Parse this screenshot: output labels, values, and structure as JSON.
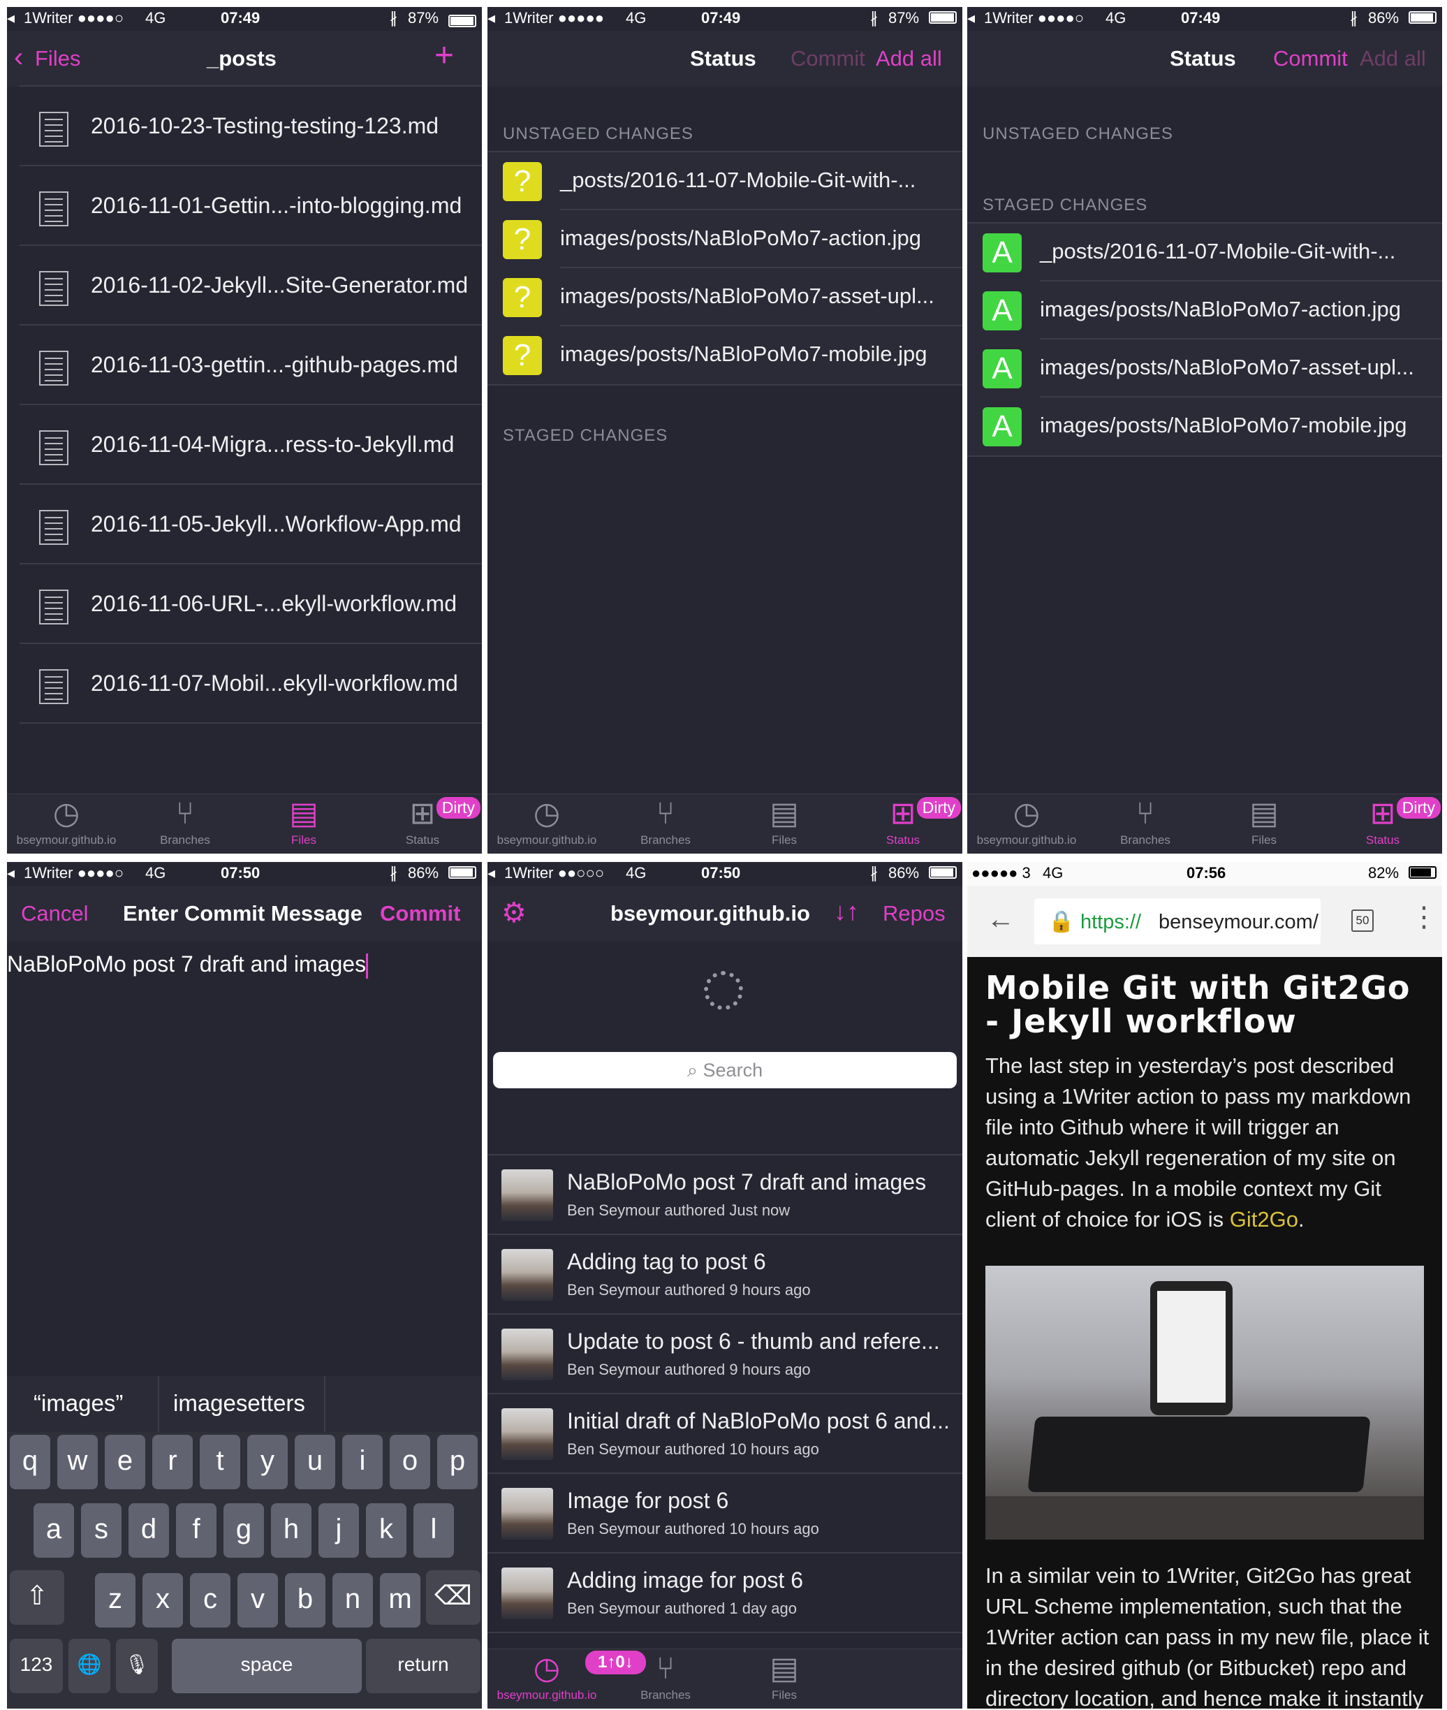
{
  "colors": {
    "accent": "#e040c8",
    "panel_bg": "#252631",
    "untracked": "#dfdc1f",
    "added": "#43d643",
    "link": "#d9c23c"
  },
  "common": {
    "tab_repo": "bseymour.github.io",
    "tab_branches": "Branches",
    "tab_files": "Files",
    "tab_status": "Status",
    "dirty": "Dirty"
  },
  "p1": {
    "carrier": "1Writer ●●●●○",
    "net": "4G",
    "time": "07:49",
    "battery": "87%",
    "back": "Files",
    "title": "_posts",
    "plus": "+",
    "files": [
      "2016-10-23-Testing-testing-123.md",
      "2016-11-01-Gettin...-into-blogging.md",
      "2016-11-02-Jekyll...Site-Generator.md",
      "2016-11-03-gettin...-github-pages.md",
      "2016-11-04-Migra...ress-to-Jekyll.md",
      "2016-11-05-Jekyll...Workflow-App.md",
      "2016-11-06-URL-...ekyll-workflow.md",
      "2016-11-07-Mobil...ekyll-workflow.md"
    ]
  },
  "p2": {
    "carrier": "1Writer ●●●●●",
    "net": "4G",
    "time": "07:49",
    "battery": "87%",
    "title": "Status",
    "commit": "Commit",
    "add_all": "Add all",
    "unstaged": "UNSTAGED CHANGES",
    "staged": "STAGED CHANGES",
    "mark": "?",
    "changes": [
      "_posts/2016-11-07-Mobile-Git-with-...",
      "images/posts/NaBloPoMo7-action.jpg",
      "images/posts/NaBloPoMo7-asset-upl...",
      "images/posts/NaBloPoMo7-mobile.jpg"
    ]
  },
  "p3": {
    "carrier": "1Writer ●●●●○",
    "net": "4G",
    "time": "07:49",
    "battery": "86%",
    "title": "Status",
    "commit": "Commit",
    "add_all": "Add all",
    "unstaged": "UNSTAGED CHANGES",
    "staged": "STAGED CHANGES",
    "mark": "A",
    "changes": [
      "_posts/2016-11-07-Mobile-Git-with-...",
      "images/posts/NaBloPoMo7-action.jpg",
      "images/posts/NaBloPoMo7-asset-upl...",
      "images/posts/NaBloPoMo7-mobile.jpg"
    ]
  },
  "p4": {
    "carrier": "1Writer ●●●●○",
    "net": "4G",
    "time": "07:50",
    "battery": "86%",
    "cancel": "Cancel",
    "title": "Enter Commit Message",
    "commit": "Commit",
    "message": "NaBloPoMo post 7 draft and images",
    "suggest1": "“images”",
    "suggest2": "imagesetters",
    "row1": [
      "q",
      "w",
      "e",
      "r",
      "t",
      "y",
      "u",
      "i",
      "o",
      "p"
    ],
    "row2": [
      "a",
      "s",
      "d",
      "f",
      "g",
      "h",
      "j",
      "k",
      "l"
    ],
    "row3": [
      "z",
      "x",
      "c",
      "v",
      "b",
      "n",
      "m"
    ],
    "key_123": "123",
    "key_space": "space",
    "key_return": "return",
    "key_shift": "⇧",
    "key_delete": "⌫",
    "key_globe": "🌐",
    "key_mic": "🎙"
  },
  "p5": {
    "carrier": "1Writer ●●○○○",
    "net": "4G",
    "time": "07:50",
    "battery": "86%",
    "title": "bseymour.github.io",
    "repos": "Repos",
    "search": "Search",
    "sync": "1↑0↓",
    "commits": [
      {
        "msg": "NaBloPoMo post 7 draft and images",
        "sub": "Ben Seymour authored Just now"
      },
      {
        "msg": "Adding tag to post 6",
        "sub": "Ben Seymour authored 9 hours ago"
      },
      {
        "msg": "Update to post 6 - thumb and refere...",
        "sub": "Ben Seymour authored 9 hours ago"
      },
      {
        "msg": "Initial draft of NaBloPoMo post 6 and...",
        "sub": "Ben Seymour authored 10 hours ago"
      },
      {
        "msg": "Image for post 6",
        "sub": "Ben Seymour authored 10 hours ago"
      },
      {
        "msg": "Adding image for post 6",
        "sub": "Ben Seymour authored 1 day ago"
      }
    ]
  },
  "p6": {
    "carrier": "●●●●● 3",
    "net": "4G",
    "time": "07:56",
    "battery": "82%",
    "url_scheme": "https://",
    "url_host": "benseymour.com/",
    "tabs_count": "50",
    "heading": "Mobile Git with Git2Go - Jekyll workflow",
    "para1": "The last step in yesterday’s post described using a 1Writer action to pass my markdown file into Github where it will trigger an automatic Jekyll regeneration of my site on GitHub-pages. In a mobile context my Git client of choice for iOS is ",
    "para1_link": "Git2Go",
    "para1_end": ".",
    "para2": "In a similar vein to 1Writer, Git2Go has great URL Scheme implementation, such that the 1Writer action can pass in my new file, place it in the desired github (or Bitbucket) repo and directory location, and hence make it instantly"
  }
}
